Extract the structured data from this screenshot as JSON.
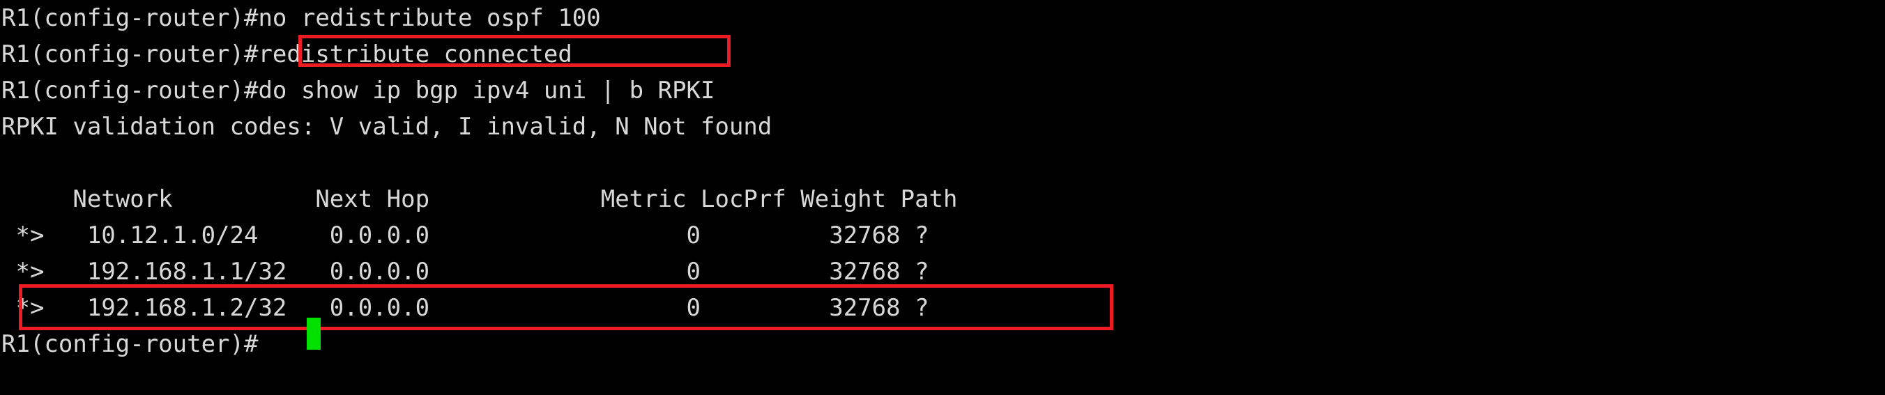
{
  "terminal": {
    "title": "Cisco IOS CLI session",
    "background_color": "#000000",
    "foreground_color": "#d8d8d8",
    "annotation_color": "#ed1c24",
    "cursor_color": "#00e000",
    "prompt": "R1(config-router)#",
    "lines": [
      {
        "id": "line-1",
        "text": "R1(config-router)#no redistribute ospf 100"
      },
      {
        "id": "line-2",
        "text": "R1(config-router)#redistribute connected"
      },
      {
        "id": "line-3",
        "text": "R1(config-router)#do show ip bgp ipv4 uni | b RPKI"
      },
      {
        "id": "line-4",
        "text": "RPKI validation codes: V valid, I invalid, N Not found"
      },
      {
        "id": "line-5",
        "text": ""
      },
      {
        "id": "line-6",
        "text": "     Network          Next Hop            Metric LocPrf Weight Path"
      },
      {
        "id": "line-7",
        "text": " *>   10.12.1.0/24     0.0.0.0                  0         32768 ?"
      },
      {
        "id": "line-8",
        "text": " *>   192.168.1.1/32   0.0.0.0                  0         32768 ?"
      },
      {
        "id": "line-9",
        "text": " *>   192.168.1.2/32   0.0.0.0                  0         32768 ?"
      },
      {
        "id": "line-10",
        "text": "R1(config-router)#"
      }
    ],
    "commands": {
      "no_redistribute_ospf": "no redistribute ospf 100",
      "redistribute_connected": "redistribute connected",
      "show_bgp": "do show ip bgp ipv4 uni | b RPKI"
    },
    "rpki_legend": {
      "label": "RPKI validation codes:",
      "codes": [
        {
          "code": "V",
          "meaning": "valid"
        },
        {
          "code": "I",
          "meaning": "invalid"
        },
        {
          "code": "N",
          "meaning": "Not found"
        }
      ]
    },
    "bgp_table": {
      "headers": [
        "Network",
        "Next Hop",
        "Metric",
        "LocPrf",
        "Weight",
        "Path"
      ],
      "rows": [
        {
          "status": "*>",
          "network": "10.12.1.0/24",
          "next_hop": "0.0.0.0",
          "metric": "0",
          "locprf": "",
          "weight": "32768",
          "path": "?",
          "highlighted": false
        },
        {
          "status": "*>",
          "network": "192.168.1.1/32",
          "next_hop": "0.0.0.0",
          "metric": "0",
          "locprf": "",
          "weight": "32768",
          "path": "?",
          "highlighted": false
        },
        {
          "status": "*>",
          "network": "192.168.1.2/32",
          "next_hop": "0.0.0.0",
          "metric": "0",
          "locprf": "",
          "weight": "32768",
          "path": "?",
          "highlighted": true
        }
      ]
    },
    "annotations": [
      {
        "id": "annot-command",
        "label": "redistribute-connected-highlight"
      },
      {
        "id": "annot-route",
        "label": "new-route-192.168.1.2-highlight"
      }
    ],
    "cursor": {
      "label": "block-cursor",
      "visible": true
    }
  }
}
